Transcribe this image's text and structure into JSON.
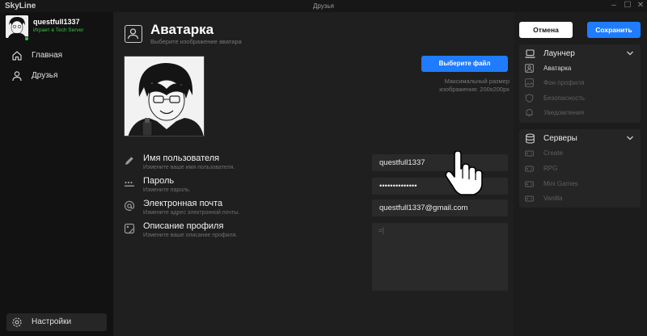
{
  "window": {
    "app_name": "SkyLine",
    "title": "Друзья"
  },
  "user": {
    "name": "questfull1337",
    "status": "Играет в Tech Server"
  },
  "sidebar": {
    "items": [
      {
        "label": "Главная",
        "icon": "home-icon"
      },
      {
        "label": "Друзья",
        "icon": "user-icon"
      }
    ],
    "settings_label": "Настройки"
  },
  "header": {
    "title": "Аватарка",
    "subtitle": "Выберите изображение аватара"
  },
  "avatar": {
    "choose_button": "Выберите файл",
    "max_size_line1": "Максимальный размер",
    "max_size_line2": "изображения: 200x200px"
  },
  "fields": [
    {
      "label": "Имя пользователя",
      "description": "Измените ваше имя пользователя.",
      "icon": "pencil-icon",
      "value": "questfull1337"
    },
    {
      "label": "Пароль",
      "description": "Измените пароль.",
      "icon": "password-icon",
      "value": "••••••••••••••"
    },
    {
      "label": "Электронная почта",
      "description": "Измените адрес электронной почты.",
      "icon": "at-icon",
      "value": "questfull1337@gmail.com"
    },
    {
      "label": "Описание профиля",
      "description": "Измените ваше описание профиля.",
      "icon": "image-edit-icon",
      "value": "=]"
    }
  ],
  "actions": {
    "cancel": "Отмена",
    "save": "Сохранить"
  },
  "launcher_panel": {
    "title": "Лаунчер",
    "items": [
      {
        "label": "Аватарка",
        "icon": "avatar-icon",
        "active": true
      },
      {
        "label": "Фон профиля",
        "icon": "image-icon",
        "active": false
      },
      {
        "label": "Безопасность",
        "icon": "shield-icon",
        "active": false
      },
      {
        "label": "Уведомления",
        "icon": "bell-icon",
        "active": false
      }
    ]
  },
  "servers_panel": {
    "title": "Серверы",
    "items": [
      {
        "label": "Create",
        "icon": "gamepad-icon"
      },
      {
        "label": "RPG",
        "icon": "gamepad-icon"
      },
      {
        "label": "Mini Games",
        "icon": "gamepad-icon"
      },
      {
        "label": "Vanilla",
        "icon": "gamepad-icon"
      }
    ]
  },
  "colors": {
    "accent": "#1f7cff",
    "online": "#2ecc40",
    "sidebar_bg": "#121212",
    "main_bg": "#1f1f1f"
  }
}
